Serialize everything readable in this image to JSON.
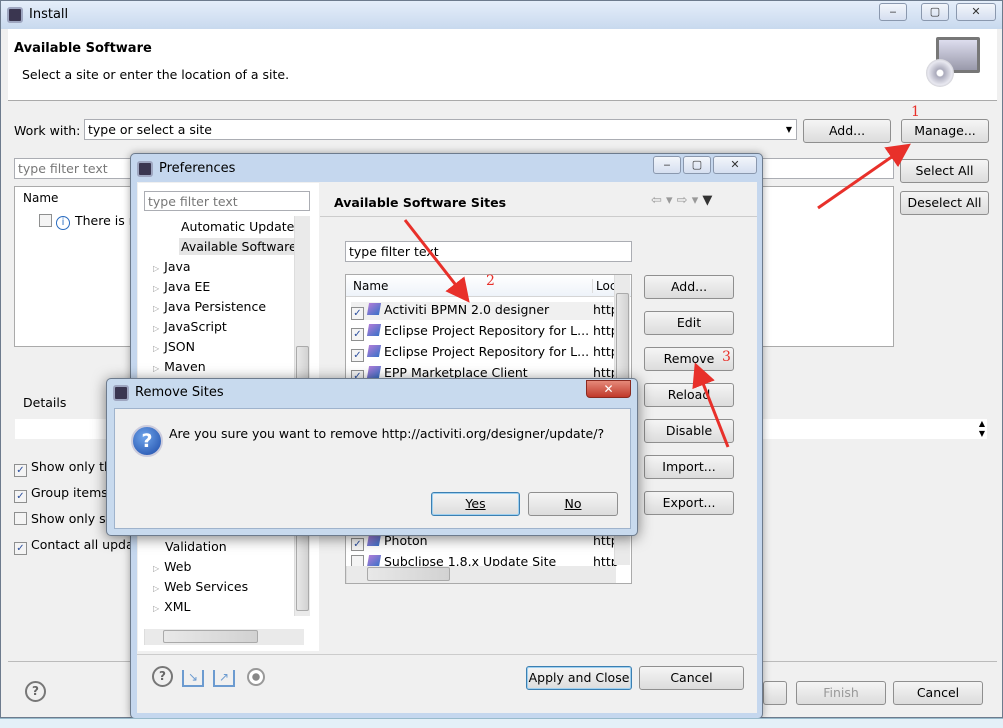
{
  "install": {
    "title": "Install",
    "header_title": "Available Software",
    "header_subtitle": "Select a site or enter the location of a site.",
    "work_with_label": "Work with:",
    "work_with_placeholder": "type or select a site",
    "add_button": "Add...",
    "manage_button": "Manage...",
    "filter_placeholder": "type filter text",
    "select_all": "Select All",
    "deselect_all": "Deselect All",
    "name_column": "Name",
    "info_row": "There is n",
    "details_label": "Details",
    "options": [
      {
        "label": "Show only the",
        "checked": true
      },
      {
        "label": "Group items",
        "checked": true
      },
      {
        "label": "Show only so",
        "checked": false
      },
      {
        "label": "Contact all updat",
        "checked": true
      }
    ],
    "finish_button": "Finish",
    "cancel_button": "Cancel",
    "window_controls": {
      "minimize": "‒",
      "maximize": "▢",
      "close": "✕"
    }
  },
  "preferences": {
    "title": "Preferences",
    "filter_placeholder": "type filter text",
    "tree": [
      {
        "label": "Automatic Updates",
        "child": true
      },
      {
        "label": "Available Software",
        "child": true,
        "selected": true
      },
      {
        "label": "Java"
      },
      {
        "label": "Java EE"
      },
      {
        "label": "Java Persistence"
      },
      {
        "label": "JavaScript"
      },
      {
        "label": "JSON"
      },
      {
        "label": "Maven"
      }
    ],
    "tree_bottom": [
      {
        "label": "Validation",
        "child": true
      },
      {
        "label": "Web"
      },
      {
        "label": "Web Services"
      },
      {
        "label": "XML"
      }
    ],
    "page_title": "Available Software Sites",
    "sites_filter_value": "type filter text",
    "columns": [
      "Name",
      "Loc"
    ],
    "sites": [
      {
        "name": "Activiti BPMN 2.0 designer",
        "loc": "http",
        "checked": true
      },
      {
        "name": "Eclipse Project Repository for L...",
        "loc": "http",
        "checked": true
      },
      {
        "name": "Eclipse Project Repository for L...",
        "loc": "http",
        "checked": true
      },
      {
        "name": "EPP Marketplace Client",
        "loc": "http",
        "checked": true
      }
    ],
    "sites_bottom": [
      {
        "name": "Photon",
        "loc": "http",
        "checked": true
      },
      {
        "name": "Subclipse 1.8.x Update Site",
        "loc": "http",
        "checked": false
      }
    ],
    "buttons": [
      "Add...",
      "Edit",
      "Remove",
      "Reload",
      "Disable",
      "Import...",
      "Export..."
    ],
    "apply_close": "Apply and Close",
    "cancel": "Cancel"
  },
  "remove_dialog": {
    "title": "Remove Sites",
    "message": "Are you sure you want to remove http://activiti.org/designer/update/?",
    "yes": "Yes",
    "no": "No",
    "close": "✕"
  },
  "annotations": {
    "step1": "1",
    "step2": "2",
    "step3": "3",
    "color": "#e8302a"
  }
}
